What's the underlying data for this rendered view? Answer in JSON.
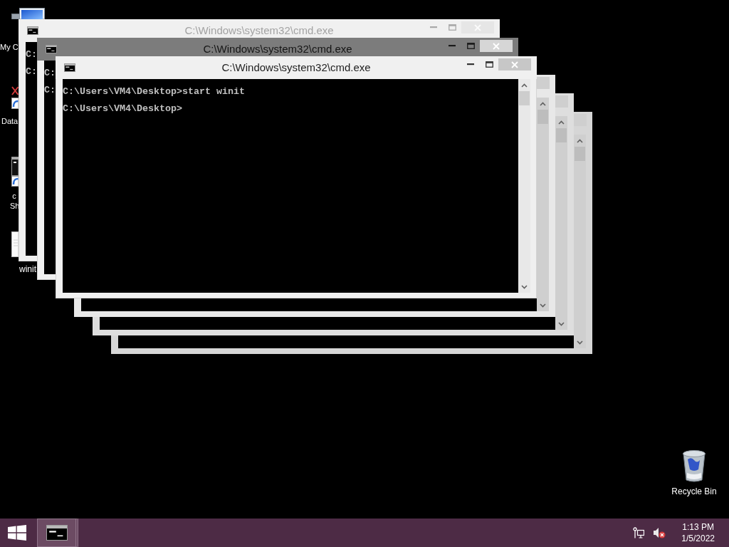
{
  "desktop": {
    "icons": [
      {
        "kind": "computer",
        "label_lines": [
          "My C"
        ]
      },
      {
        "kind": "missing",
        "label_lines": [
          "Data"
        ]
      },
      {
        "kind": "console",
        "label_lines": [
          "c",
          "Sh"
        ]
      },
      {
        "kind": "file",
        "label_lines": [
          "winit"
        ]
      },
      {
        "kind": "bin",
        "label_lines": [
          "Recycle Bin"
        ]
      }
    ]
  },
  "windows": [
    {
      "kind": "faded",
      "title": "C:\\Windows\\system32\\cmd.exe",
      "lines": [
        "C:",
        "C:"
      ]
    },
    {
      "kind": "dimmed",
      "title": "C:\\Windows\\system32\\cmd.exe",
      "lines": [
        "C:",
        "C:"
      ]
    },
    {
      "kind": "normal",
      "title": "C:\\Windows\\system32\\cmd.exe",
      "lines": [
        "C:\\Users\\VM4\\Desktop>start winit",
        "C:\\Users\\VM4\\Desktop>"
      ]
    }
  ],
  "taskbar": {
    "apps": [
      {
        "selected": true
      }
    ],
    "tray": {
      "volume_muted": true
    },
    "clock": {
      "time": "1:13 PM",
      "date": "1/5/2022"
    }
  }
}
